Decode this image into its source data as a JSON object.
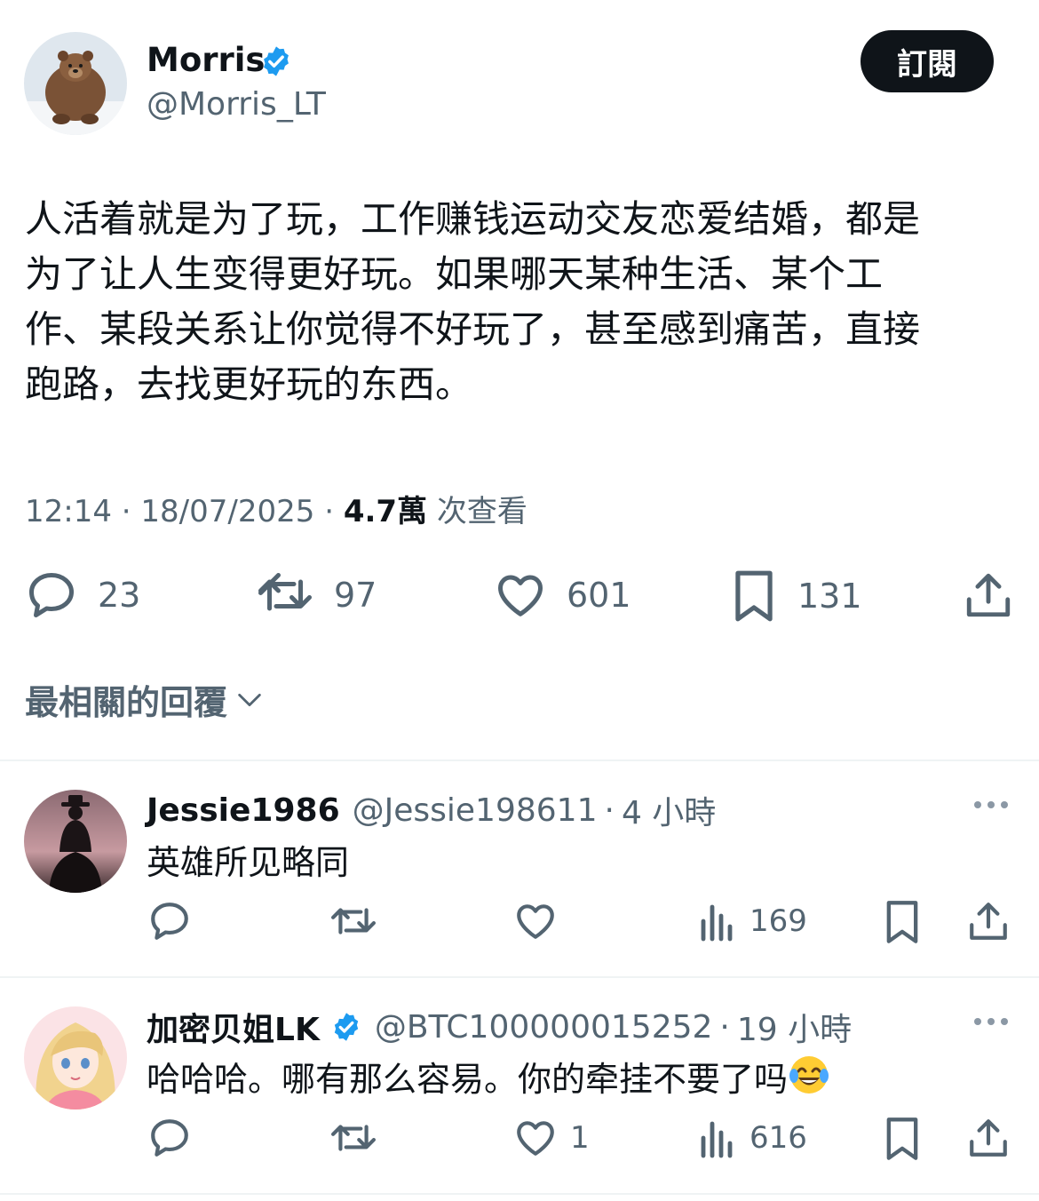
{
  "tweet": {
    "author": {
      "name": "Morris",
      "handle": "@Morris_LT",
      "verified": true,
      "avatar": "bear-avatar"
    },
    "subscribe_label": "訂閱",
    "text_lines": [
      "人活着就是为了玩，工作赚钱运动交友恋爱结婚，都是",
      "为了让人生变得更好玩。如果哪天某种生活、某个工",
      "作、某段关系让你觉得不好玩了，甚至感到痛苦，直接",
      "跑路，去找更好玩的东西。"
    ],
    "time": "12:14",
    "date": "18/07/2025",
    "views_count": "4.7萬",
    "views_label": "次查看",
    "stats": {
      "replies": "23",
      "reposts": "97",
      "likes": "601",
      "bookmarks": "131"
    }
  },
  "replies_filter": {
    "label": "最相關的回覆",
    "icon": "chevron-down-icon"
  },
  "replies": [
    {
      "name": "Jessie1986",
      "handle": "@Jessie198611",
      "time": "4 小時",
      "verified": false,
      "text": "英雄所见略同",
      "likes": "",
      "views": "169",
      "avatar": "cowboy-avatar"
    },
    {
      "name": "加密贝姐LK",
      "handle": "@BTC100000015252",
      "time": "19 小時",
      "verified": true,
      "text": "哈哈哈。哪有那么容易。你的牵挂不要了吗",
      "emoji": "face-with-tears-of-joy",
      "likes": "1",
      "views": "616",
      "avatar": "anime-girl-avatar"
    }
  ],
  "colors": {
    "text": "#0f1419",
    "secondary": "#536471",
    "verified": "#1d9bf0",
    "divider": "#eff3f4"
  }
}
